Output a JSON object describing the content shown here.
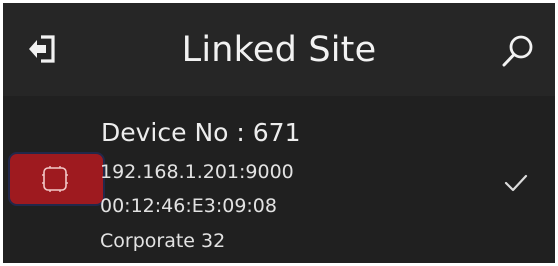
{
  "header": {
    "title": "Linked Site",
    "back_icon": "exit-arrow-icon",
    "search_icon": "search-icon"
  },
  "device": {
    "name": "Device No : 671",
    "ip": "192.168.1.201:9000",
    "mac": "00:12:46:E3:09:08",
    "site": "Corporate 32",
    "selected": true,
    "badge_color": "#9e1a1f",
    "badge_icon": "device-frame-icon",
    "check_icon": "check-icon"
  },
  "colors": {
    "header_bg": "#262626",
    "list_bg": "#202020",
    "text": "#ededed"
  }
}
